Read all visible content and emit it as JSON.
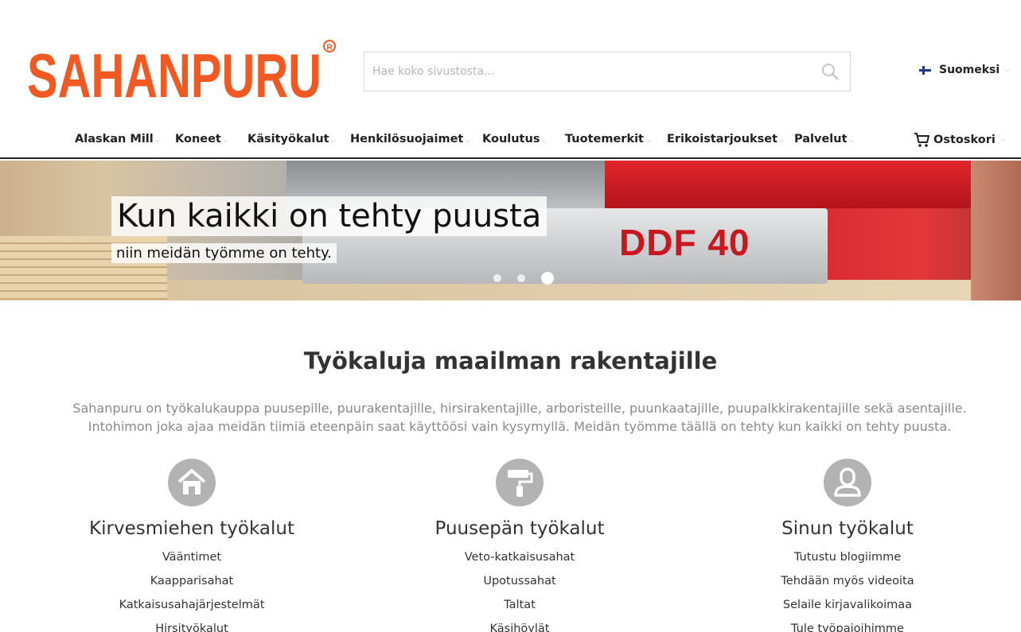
{
  "logo": {
    "text": "SAHANPURU",
    "brand_color": "#f05a22"
  },
  "search": {
    "placeholder": "Hae koko sivustosta...",
    "icon": "search-icon"
  },
  "language": {
    "label": "Suomeksi",
    "flag": "finland-flag"
  },
  "nav": {
    "items": [
      {
        "label": "Alaskan Mill"
      },
      {
        "label": "Koneet"
      },
      {
        "label": "Käsityökalut"
      },
      {
        "label": "Henkilösuojaimet"
      },
      {
        "label": "Koulutus"
      },
      {
        "label": "Tuotemerkit"
      },
      {
        "label": "Erikoistarjoukset"
      },
      {
        "label": "Palvelut"
      }
    ],
    "cart_label": "Ostoskori"
  },
  "hero": {
    "title": "Kun kaikki on tehty puusta",
    "subtitle": "niin meidän työmme on tehty.",
    "model_label": "DDF 40",
    "slides": 3,
    "active_slide": 3
  },
  "intro": {
    "title": "Työkaluja maailman rakentajille",
    "text": "Sahanpuru on työkalukauppa puusepille, puurakentajille, hirsirakentajille, arboristeille, puunkaatajille, puupalkkirakentajille sekä asentajille. Intohimon joka ajaa meidän tiimiä eteenpäin saat käyttöösi vain kysymyllä. Meidän työmme täällä on tehty kun kaikki on tehty puusta."
  },
  "columns": [
    {
      "icon": "house-icon",
      "title": "Kirvesmiehen työkalut",
      "links": [
        "Vääntimet",
        "Kaapparisahat",
        "Katkaisusahajärjestelmät",
        "Hirsityökalut"
      ]
    },
    {
      "icon": "paint-roller-icon",
      "title": "Puusepän työkalut",
      "links": [
        "Veto-katkaisusahat",
        "Upotussahat",
        "Taltat",
        "Käsihöylät"
      ]
    },
    {
      "icon": "user-icon",
      "title": "Sinun työkalut",
      "links": [
        "Tutustu blogiimme",
        "Tehdään myös videoita",
        "Selaile kirjavalikoimaa",
        "Tule työpajoihimme"
      ]
    }
  ]
}
